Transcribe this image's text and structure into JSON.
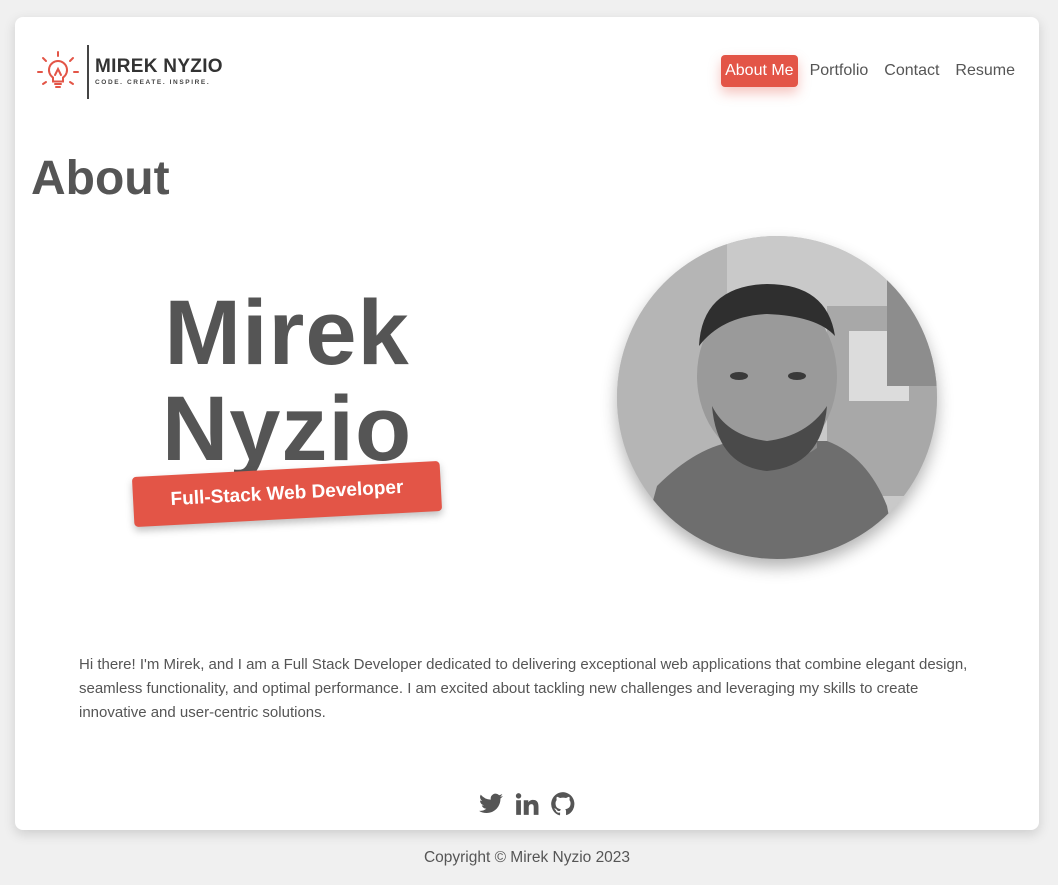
{
  "header": {
    "logo": {
      "name": "MIREK NYZIO",
      "tagline": "CODE. CREATE. INSPIRE.",
      "icon": "lightbulb-icon"
    },
    "nav": [
      {
        "label": "About Me",
        "active": true
      },
      {
        "label": "Portfolio",
        "active": false
      },
      {
        "label": "Contact",
        "active": false
      },
      {
        "label": "Resume",
        "active": false
      }
    ]
  },
  "main": {
    "title": "About",
    "hero": {
      "first_name": "Mirek",
      "last_name": "Nyzio",
      "badge": "Full-Stack Web Developer"
    },
    "bio": "Hi there! I'm Mirek, and I am a Full Stack Developer dedicated to delivering exceptional web applications that combine elegant design, seamless functionality, and optimal performance. I am excited about tackling new challenges and leveraging my skills to create innovative and user-centric solutions.",
    "social": [
      "twitter-icon",
      "linkedin-icon",
      "github-icon"
    ]
  },
  "footer": {
    "copyright": "Copyright © Mirek Nyzio 2023"
  },
  "colors": {
    "accent": "#e35547",
    "text": "#555555",
    "background": "#f0f0f0",
    "card": "#ffffff"
  }
}
